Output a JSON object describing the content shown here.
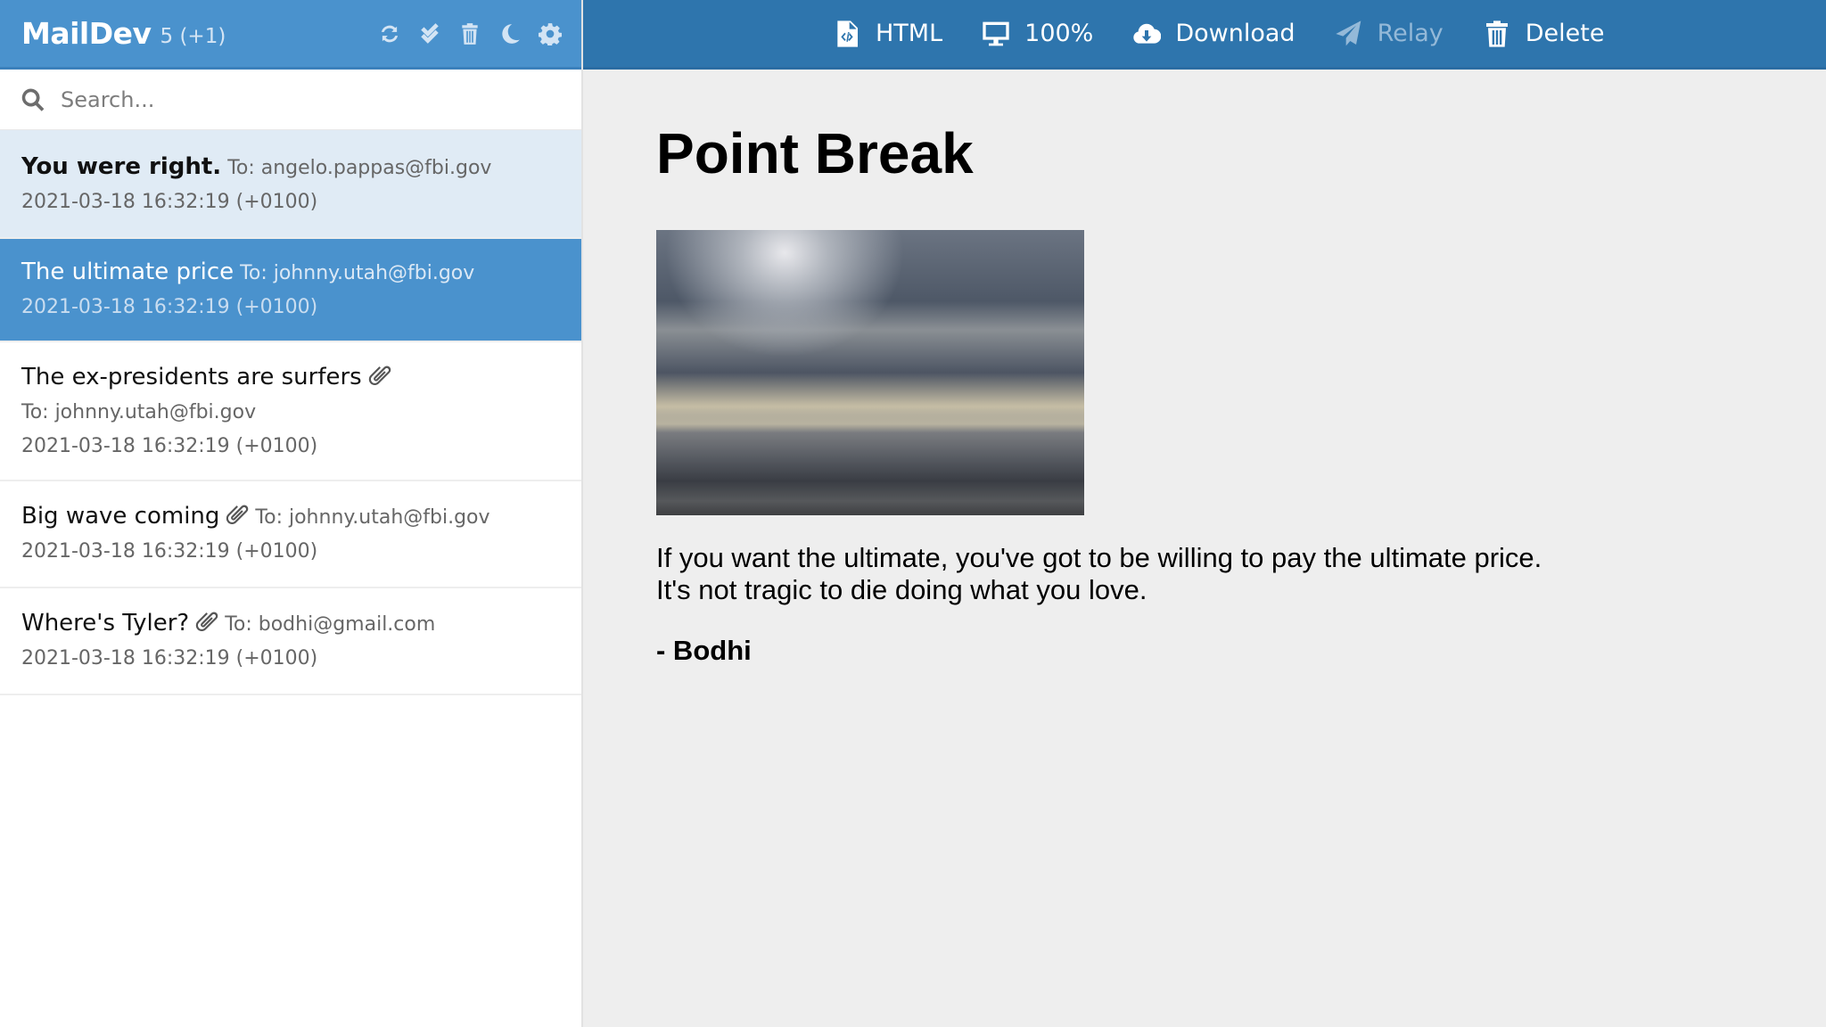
{
  "app": {
    "title": "MailDev",
    "count": "5 (+1)"
  },
  "header_tools": [
    {
      "name": "refresh",
      "icon": "refresh-icon"
    },
    {
      "name": "mark-all-read",
      "icon": "double-check-icon"
    },
    {
      "name": "delete-all",
      "icon": "trash-icon"
    },
    {
      "name": "dark-mode",
      "icon": "moon-icon"
    },
    {
      "name": "settings",
      "icon": "gear-icon"
    }
  ],
  "search": {
    "placeholder": "Search...",
    "value": ""
  },
  "emails": [
    {
      "subject": "You were right.",
      "to": "To: angelo.pappas@fbi.gov",
      "date": "2021-03-18 16:32:19 (+0100)",
      "attachment": false,
      "state": "read"
    },
    {
      "subject": "The ultimate price",
      "to": "To: johnny.utah@fbi.gov",
      "date": "2021-03-18 16:32:19 (+0100)",
      "attachment": false,
      "state": "selected"
    },
    {
      "subject": "The ex-presidents are surfers",
      "to": "To: johnny.utah@fbi.gov",
      "date": "2021-03-18 16:32:19 (+0100)",
      "attachment": true,
      "state": "unread"
    },
    {
      "subject": "Big wave coming",
      "to": "To: johnny.utah@fbi.gov",
      "date": "2021-03-18 16:32:19 (+0100)",
      "attachment": true,
      "state": "unread"
    },
    {
      "subject": "Where's Tyler?",
      "to": "To: bodhi@gmail.com",
      "date": "2021-03-18 16:32:19 (+0100)",
      "attachment": true,
      "state": "unread"
    }
  ],
  "toolbar": {
    "html_label": "HTML",
    "zoom_label": "100%",
    "download_label": "Download",
    "relay_label": "Relay",
    "delete_label": "Delete"
  },
  "preview": {
    "heading": "Point Break",
    "image_alt": "Cloudy sky over the ocean",
    "paragraph_line1": "If you want the ultimate, you've got to be willing to pay the ultimate price.",
    "paragraph_line2": "It's not tragic to die doing what you love.",
    "signature": "- Bodhi"
  },
  "colors": {
    "sidebar_header": "#4a92cd",
    "toolbar": "#2e75ad",
    "selected_item": "#4a92cd",
    "read_item": "#e0ebf5",
    "background": "#eeeeee"
  }
}
